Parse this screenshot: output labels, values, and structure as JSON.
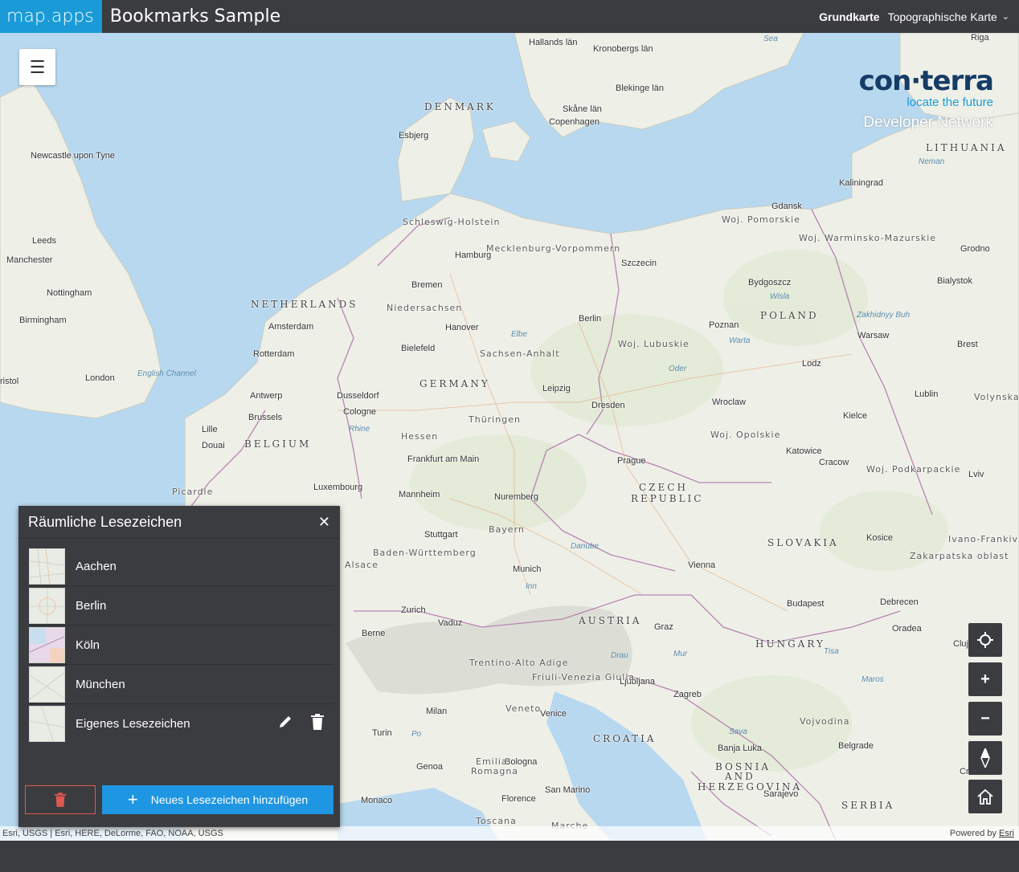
{
  "header": {
    "brand": "map.apps",
    "title": "Bookmarks Sample",
    "basemap_label": "Grundkarte",
    "basemap_value": "Topographische Karte"
  },
  "logo": {
    "name": "con·terra",
    "tagline": "locate the future",
    "network": "Developer Network"
  },
  "map": {
    "countries": [
      "DENMARK",
      "NETHERLANDS",
      "BELGIUM",
      "GERMANY",
      "POLAND",
      "CZECH",
      "REPUBLIC",
      "SLOVAKIA",
      "AUSTRIA",
      "HUNGARY",
      "CROATIA",
      "BOSNIA",
      "AND",
      "HERZEGOVINA",
      "SERBIA",
      "LITHUANIA"
    ],
    "cities": [
      "Riga",
      "Hallands län",
      "Kronobergs län",
      "Blekinge län",
      "Skåne län",
      "Copenhagen",
      "Esbjerg",
      "Newcastle upon Tyne",
      "Leeds",
      "Manchester",
      "Nottingham",
      "Birmingham",
      "London",
      "ristol",
      "Kaliningrad",
      "Gdansk",
      "Grodno",
      "Bialystok",
      "Hamburg",
      "Bremen",
      "Szczecin",
      "Bydgoszcz",
      "Amsterdam",
      "Rotterdam",
      "Hanover",
      "Berlin",
      "Bielefeld",
      "Poznan",
      "Warsaw",
      "Brest",
      "Antwerp",
      "Brussels",
      "Dusseldorf",
      "Cologne",
      "Leipzig",
      "Dresden",
      "Lodz",
      "Lublin",
      "Lille",
      "Douai",
      "Wroclaw",
      "Kielce",
      "Frankfurt am Main",
      "Prague",
      "Katowice",
      "Cracow",
      "Luxembourg",
      "Mannheim",
      "Nuremberg",
      "Lviv",
      "Stuttgart",
      "Kosice",
      "Munich",
      "Vienna",
      "Zurich",
      "Vaduz",
      "Budapest",
      "Debrecen",
      "Berne",
      "Graz",
      "Oradea",
      "Cluj",
      "Ljubljana",
      "Zagreb",
      "Milan",
      "Venice",
      "Turin",
      "Genoa",
      "Bologna",
      "Banja Luka",
      "Belgrade",
      "Monaco",
      "Florence",
      "San Marino",
      "Sarajevo",
      "Toscana",
      "Marche",
      "Emilia",
      "Romagna",
      "Veneto",
      "Vojvodina",
      "Craiova"
    ],
    "regions": [
      "Schleswig-Holstein",
      "Mecklenburg-Vorpommern",
      "Niedersachsen",
      "Sachsen-Anhalt",
      "Thüringen",
      "Hessen",
      "Bayern",
      "Baden-Württemberg",
      "Alsace",
      "Picardie",
      "Woj. Pomorskie",
      "Woj. Warminsko-Mazurskie",
      "Woj. Lubuskie",
      "Woj. Opolskie",
      "Woj. Podkarpackie",
      "Volynska oblast",
      "Zakarpatska oblast",
      "Ivano-Frankivsk oblast",
      "Trentino-Alto Adige",
      "Friuli-Venezia Giulia",
      "Sea"
    ],
    "water": [
      "English Channel",
      "Elbe",
      "Oder",
      "Warta",
      "Wisla",
      "Neman",
      "Danube",
      "Inn",
      "Rhine",
      "Drau",
      "Mur",
      "Sava",
      "Tisa",
      "Maros",
      "Po",
      "Zakhidnyy Buh"
    ]
  },
  "tools": {
    "locate_icon": "crosshair-icon",
    "zoom_in": "+",
    "zoom_out": "−",
    "compass_icon": "compass-icon",
    "home_icon": "home-icon"
  },
  "panel": {
    "title": "Räumliche Lesezeichen",
    "close": "✕",
    "bookmarks": [
      {
        "name": "Aachen"
      },
      {
        "name": "Berlin"
      },
      {
        "name": "Köln"
      },
      {
        "name": "München"
      },
      {
        "name": "Eigenes Lesezeichen"
      }
    ],
    "add_label": "Neues Lesezeichen hinzufügen"
  },
  "attribution": {
    "text": "Esri, USGS | Esri, HERE, DeLorme, FAO, NOAA, USGS",
    "powered_prefix": "Powered by",
    "powered_link": "Esri"
  },
  "colors": {
    "brand_blue": "#1a9bd7",
    "bar": "#3b3c40",
    "delete_red": "#e0584f",
    "add_blue": "#1f96e2"
  }
}
